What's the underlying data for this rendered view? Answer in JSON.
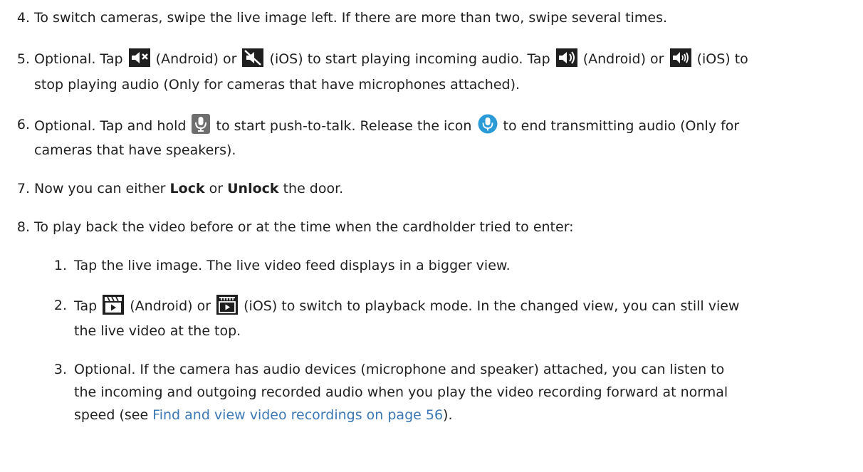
{
  "steps": [
    {
      "number": "4.",
      "line1": "To switch cameras, swipe the live image left. If there are more than two, swipe several times."
    },
    {
      "number": "5.",
      "line1_a": "Optional. Tap",
      "line1_b": "(Android) or",
      "line1_c": "(iOS) to start playing incoming audio. Tap",
      "line1_d": "(Android) or",
      "line1_e": "(iOS) to",
      "line2": "stop playing audio (Only for cameras that have microphones attached)."
    },
    {
      "number": "6.",
      "line1_a": "Optional. Tap and hold",
      "line1_b": "to start push-to-talk. Release the icon",
      "line1_c": "to end transmitting audio (Only for",
      "line2": "cameras that have speakers)."
    },
    {
      "number": "7.",
      "text_a": "Now you can either ",
      "bold_lock": "Lock",
      "text_b": " or ",
      "bold_unlock": "Unlock",
      "text_c": " the door."
    },
    {
      "number": "8.",
      "line1": "To play back the video before or at the time when the cardholder tried to enter:"
    }
  ],
  "substeps": [
    {
      "number": "1.",
      "line1": "Tap the live image. The live video feed displays in a bigger view."
    },
    {
      "number": "2.",
      "line1_a": "Tap",
      "line1_b": "(Android) or",
      "line1_c": "(iOS) to switch to playback mode. In the changed view, you can still view",
      "line2": "the live video at the top."
    },
    {
      "number": "3.",
      "line1": "Optional. If the camera has audio devices (microphone and speaker) attached, you can listen to",
      "line2": "the incoming and outgoing recorded audio when you play the video recording forward at normal",
      "line3_a": "speed (see ",
      "line3_link": "Find and view video recordings on page 56",
      "line3_b": ")."
    }
  ],
  "icons": {
    "muted_android": "speaker-muted-android-icon",
    "muted_ios": "speaker-muted-ios-icon",
    "unmuted_android": "speaker-on-android-icon",
    "unmuted_ios": "speaker-on-ios-icon",
    "mic_gray": "microphone-icon",
    "mic_active": "microphone-active-icon",
    "playback_android": "playback-android-icon",
    "playback_ios": "playback-ios-icon"
  },
  "colors": {
    "link": "#3b78b6",
    "icon_dark": "#1f1f1f",
    "mic_active": "#2a9bd6"
  }
}
